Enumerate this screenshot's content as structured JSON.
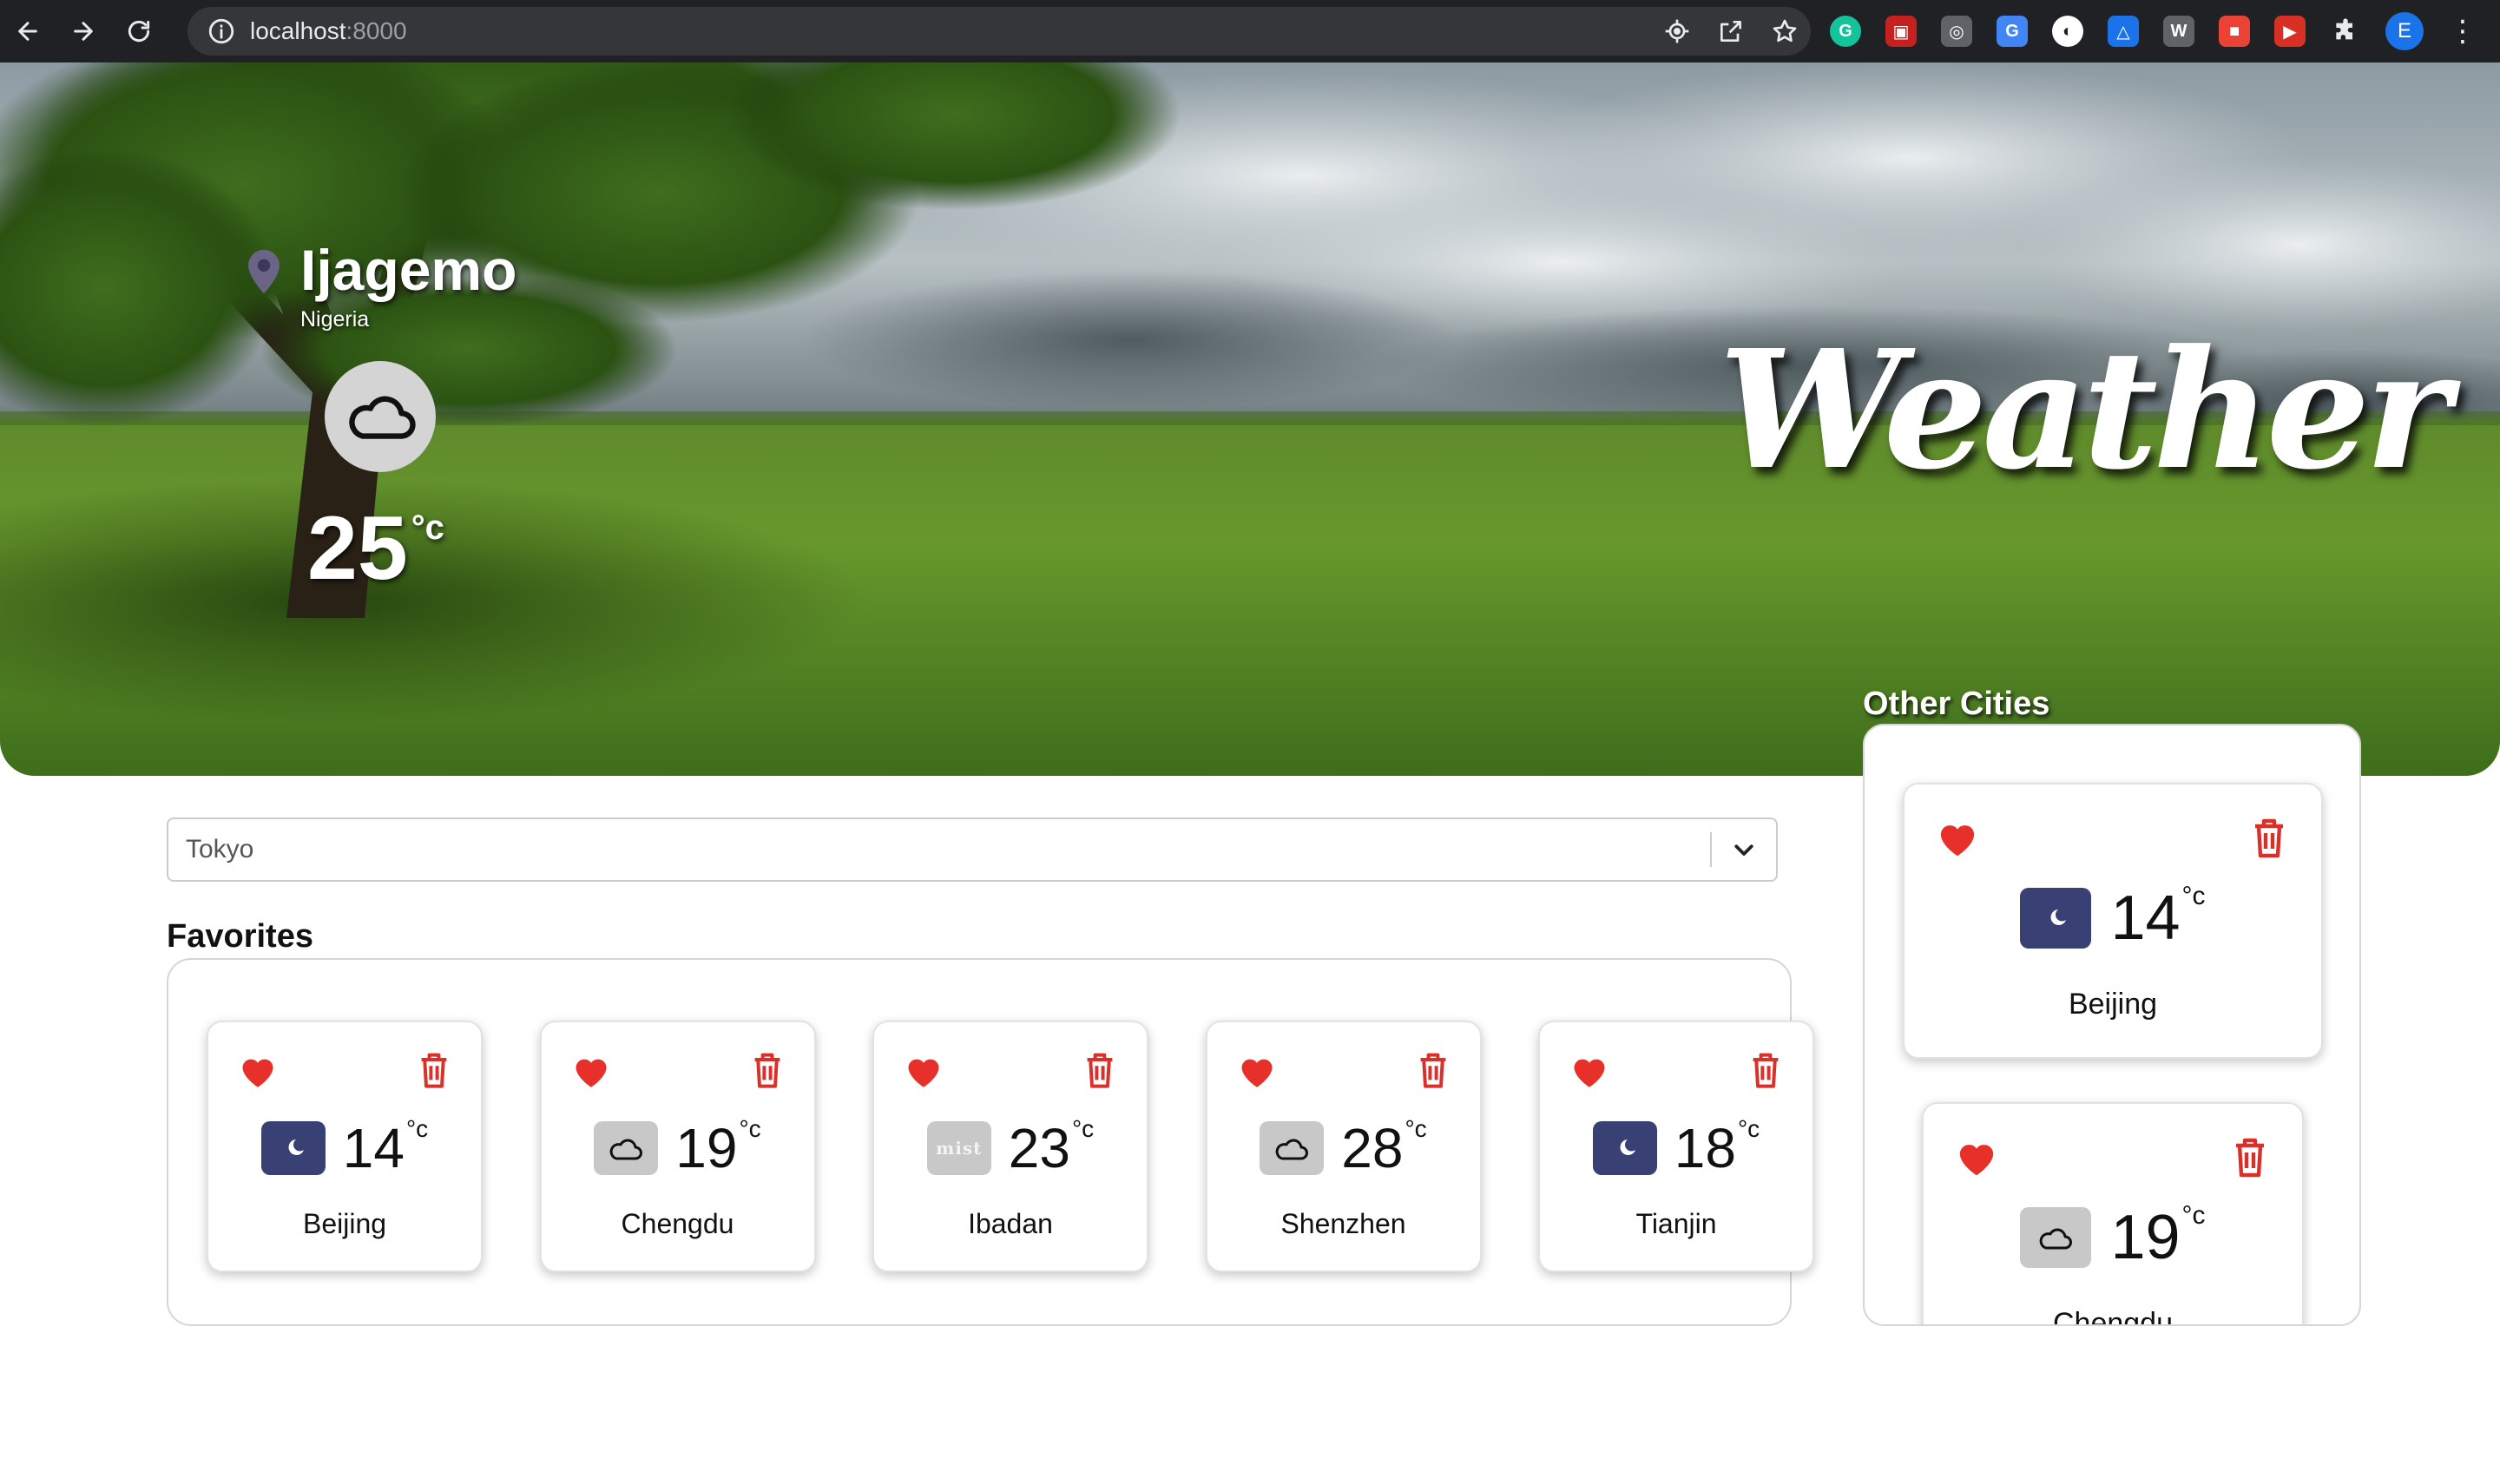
{
  "browser": {
    "url_host": "localhost",
    "url_port": ":8000",
    "profile_initial": "E",
    "extensions": [
      {
        "name": "grammarly-icon",
        "color": "#15c39a",
        "glyph": "G"
      },
      {
        "name": "extension-red-icon",
        "color": "#c5221f",
        "glyph": "▣"
      },
      {
        "name": "extension-target-icon",
        "color": "#5f6368",
        "glyph": "◎"
      },
      {
        "name": "google-translate-icon",
        "color": "#4285f4",
        "glyph": "G"
      },
      {
        "name": "extension-mask-icon",
        "color": "#ffffff",
        "glyph": "◐"
      },
      {
        "name": "extension-triangle-icon",
        "color": "#1a73e8",
        "glyph": "△"
      },
      {
        "name": "extension-w-icon",
        "color": "#5f6368",
        "glyph": "W"
      },
      {
        "name": "extension-ticket-icon",
        "color": "#ea4335",
        "glyph": "■"
      },
      {
        "name": "extension-video-icon",
        "color": "#d93025",
        "glyph": "▶"
      }
    ]
  },
  "current": {
    "city": "Ijagemo",
    "country": "Nigeria",
    "temp": "25",
    "unit": "°c",
    "icon": "cloud-icon"
  },
  "brand": {
    "title": "Weather"
  },
  "search": {
    "value": "Tokyo"
  },
  "favorites": {
    "title": "Favorites",
    "items": [
      {
        "city": "Beijing",
        "temp": "14",
        "unit": "°c",
        "icon": "moon-icon"
      },
      {
        "city": "Chengdu",
        "temp": "19",
        "unit": "°c",
        "icon": "cloud-icon"
      },
      {
        "city": "Ibadan",
        "temp": "23",
        "unit": "°c",
        "icon": "mist-icon",
        "icon_text": "mist"
      },
      {
        "city": "Shenzhen",
        "temp": "28",
        "unit": "°c",
        "icon": "cloud-icon"
      },
      {
        "city": "Tianjin",
        "temp": "18",
        "unit": "°c",
        "icon": "moon-icon"
      }
    ]
  },
  "other_cities": {
    "title": "Other Cities",
    "items": [
      {
        "city": "Beijing",
        "temp": "14",
        "unit": "°c",
        "icon": "moon-icon"
      },
      {
        "city": "Chengdu",
        "temp": "19",
        "unit": "°c",
        "icon": "cloud-icon"
      }
    ]
  },
  "colors": {
    "heart": "#e8302a",
    "trash": "#d9302a",
    "night_bg": "#394074",
    "cloud_bg": "#c8c8c8"
  }
}
